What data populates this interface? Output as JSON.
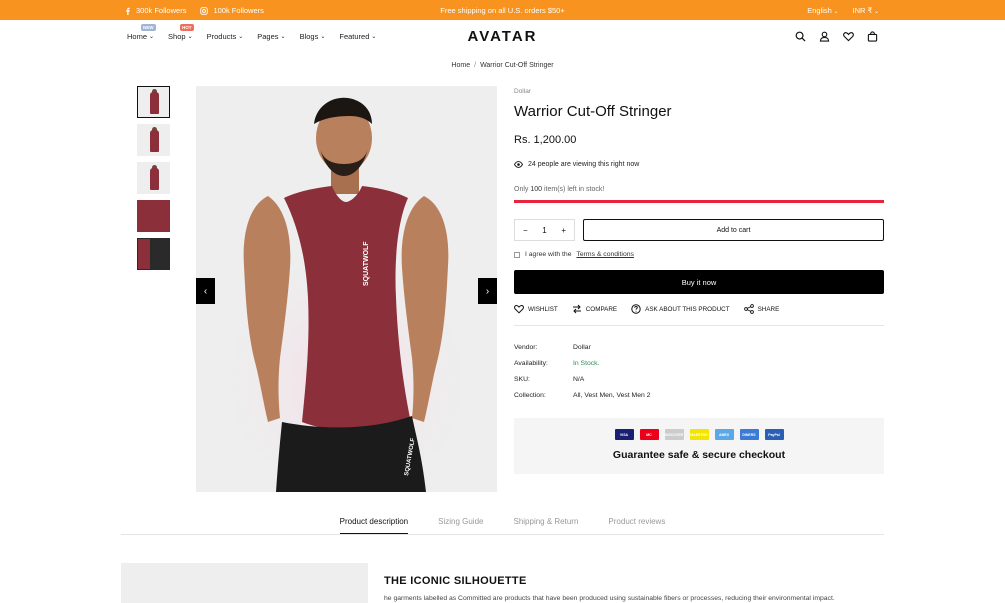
{
  "topbar": {
    "facebook_followers": "300k Followers",
    "instagram_followers": "100k Followers",
    "announcement": "Free shipping on all U.S. orders $50+",
    "language": "English",
    "currency": "INR ₹",
    "background": "#f7931e"
  },
  "header": {
    "logo": "AVATAR",
    "nav": [
      {
        "label": "Home",
        "badge": "NEW",
        "badge_color": "#9fb4d6"
      },
      {
        "label": "Shop",
        "badge": "HOT",
        "badge_color": "#f26d5b"
      },
      {
        "label": "Products",
        "badge": "",
        "badge_color": ""
      },
      {
        "label": "Pages",
        "badge": "",
        "badge_color": ""
      },
      {
        "label": "Blogs",
        "badge": "",
        "badge_color": ""
      },
      {
        "label": "Featured",
        "badge": "",
        "badge_color": ""
      }
    ],
    "icons": [
      "search-icon",
      "account-icon",
      "heart-icon",
      "bag-icon"
    ]
  },
  "breadcrumb": {
    "home": "Home",
    "separator": "/",
    "current": "Warrior Cut-Off Stringer"
  },
  "product": {
    "vendor_label_top": "Dollar",
    "title": "Warrior Cut-Off Stringer",
    "price": "Rs. 1,200.00",
    "viewing_prefix": "24",
    "viewing_text": "people are viewing this right now",
    "stock_prefix": "Only",
    "stock_count": "100",
    "stock_suffix": "item(s) left in stock!",
    "stock_level": 1.0,
    "quantity": "1",
    "qty_minus": "−",
    "qty_plus": "+",
    "add_to_cart": "Add to cart",
    "agree_prefix": "I agree with the",
    "agree_link": "Terms & conditions",
    "buy_now": "Buy it now",
    "actions": {
      "wishlist": "WISHLIST",
      "compare": "COMPARE",
      "ask": "ASK ABOUT THIS PRODUCT",
      "share": "SHARE"
    },
    "meta": {
      "vendor_label": "Vendor:",
      "vendor_value": "Dollar",
      "availability_label": "Availability:",
      "availability_value": "In Stock.",
      "sku_label": "SKU:",
      "sku_value": "N/A",
      "collection_label": "Collection:",
      "collection_value": "All, Vest Men, Vest Men 2"
    },
    "guarantee": {
      "cards": [
        {
          "name": "VISA",
          "color": "#1a1f71"
        },
        {
          "name": "MC",
          "color": "#eb001b"
        },
        {
          "name": "DISCOVER",
          "color": "#cccccc"
        },
        {
          "name": "MAESTRO",
          "color": "#f2e600"
        },
        {
          "name": "AMEX",
          "color": "#5aa9e6"
        },
        {
          "name": "DINERS",
          "color": "#3b7bd6"
        },
        {
          "name": "PayPal",
          "color": "#2b5eb5"
        }
      ],
      "text": "Guarantee safe & secure checkout"
    }
  },
  "gallery": {
    "prev": "‹",
    "next": "›",
    "brand_print": "SQUATWOLF",
    "colors": {
      "tank": "#8b2f3a",
      "skin": "#b9805e",
      "shorts": "#1b1b1b"
    }
  },
  "tabs": [
    {
      "label": "Product description",
      "active": true
    },
    {
      "label": "Sizing Guide",
      "active": false
    },
    {
      "label": "Shipping & Return",
      "active": false
    },
    {
      "label": "Product reviews",
      "active": false
    }
  ],
  "description": {
    "heading": "THE ICONIC SILHOUETTE",
    "text": "he garments labelled as Committed are products that have been produced using sustainable fibers or processes, reducing their environmental impact."
  }
}
